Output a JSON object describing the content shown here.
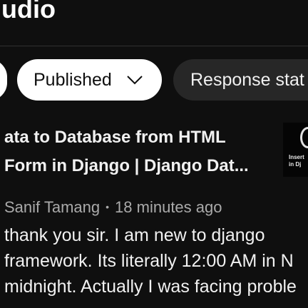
{
  "header": {
    "title": "udio"
  },
  "filters": {
    "published_label": "Published",
    "response_label": "Response stat"
  },
  "video": {
    "title_line1": "ata to Database from HTML",
    "title_line2": "Form in Django | Django Dat...",
    "thumbnail_text_line1": "Insert",
    "thumbnail_text_line2": "in Dj"
  },
  "comment": {
    "author": "Sanif Tamang",
    "separator": "•",
    "time": "18 minutes ago",
    "lines": [
      "thank you sir. I am new to django",
      "framework. Its literally 12:00 AM in N",
      "midnight. Actually I was facing proble"
    ]
  },
  "colors": {
    "background": "#0f0f0f",
    "chip_active": "#ffffff",
    "chip_inactive": "#272727",
    "text_primary": "#f1f1f1",
    "text_secondary": "#aaaaaa"
  },
  "icons": {
    "published_chevron": "chevron-down-icon"
  }
}
